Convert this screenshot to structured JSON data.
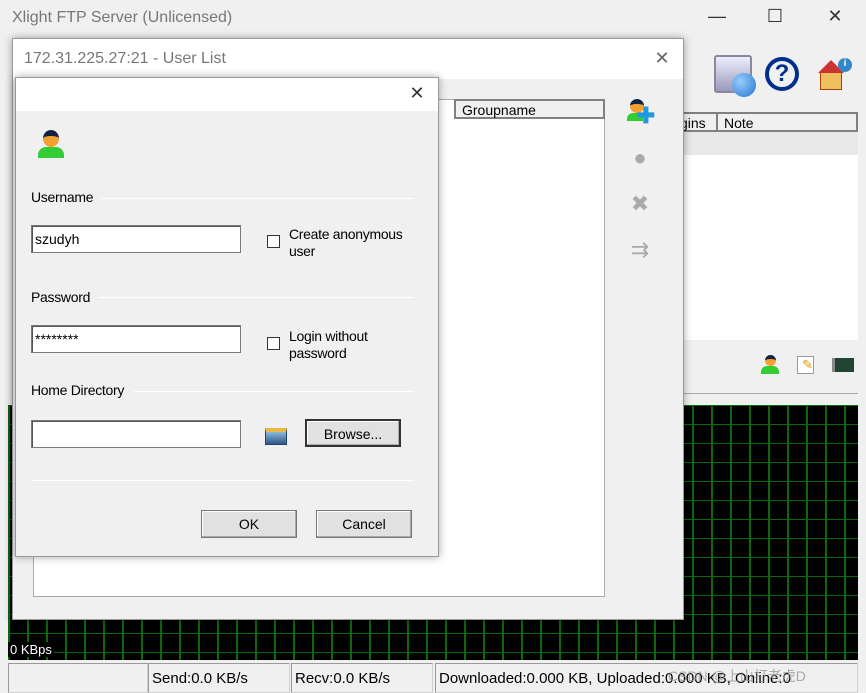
{
  "main": {
    "title": "Xlight FTP Server (Unlicensed)",
    "minimize": "—",
    "maximize": "☐",
    "close": "✕",
    "columns": [
      "gins",
      "Note"
    ],
    "graph_label": "0 KBps",
    "status": [
      "",
      "Send:0.0 KB/s",
      "Recv:0.0 KB/s",
      "Downloaded:0.000 KB, Uploaded:0.000 KB, Online:0"
    ],
    "watermark": "CSDN @上山打老虎D",
    "toolbar_icons": [
      "web-globe-icon",
      "help-icon",
      "home-info-icon"
    ],
    "bottom_icons": [
      "user-icon",
      "edit-icon",
      "network-card-icon"
    ]
  },
  "user_list": {
    "title": "172.31.225.27:21 - User List",
    "close": "✕",
    "columns": [
      "Groupname"
    ],
    "side_icons": [
      "add-user-icon",
      "edit-user-icon",
      "delete-user-icon",
      "copy-user-icon"
    ]
  },
  "user_dialog": {
    "close": "✕",
    "username_label": "Username",
    "username_value": "szudyh",
    "anonymous_label": "Create anonymous user",
    "anonymous_checked": false,
    "password_label": "Password",
    "password_value": "********",
    "no_password_label": "Login without password",
    "no_password_checked": false,
    "home_label": "Home Directory",
    "home_value": "",
    "browse": "Browse...",
    "ok": "OK",
    "cancel": "Cancel"
  },
  "colors": {
    "graph_bg": "#000000",
    "grid": "#0a6a0a"
  }
}
